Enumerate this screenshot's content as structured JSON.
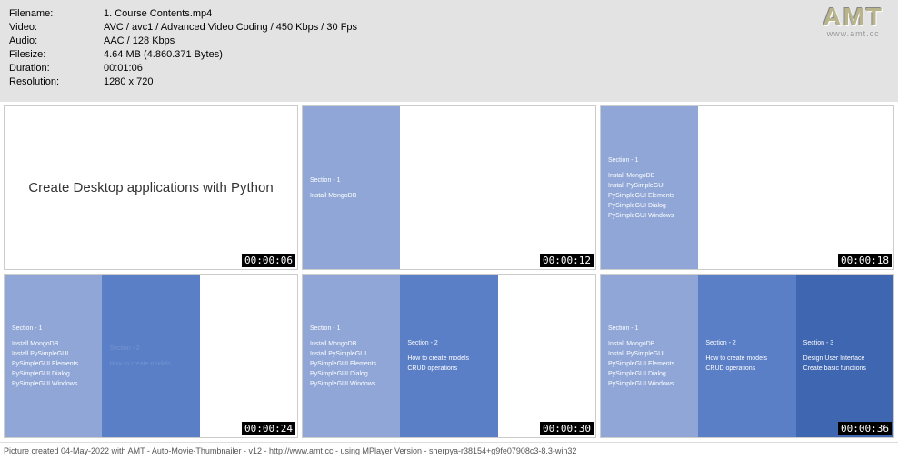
{
  "meta": {
    "filename_label": "Filename:",
    "filename": "1. Course Contents.mp4",
    "video_label": "Video:",
    "video": "AVC / avc1 / Advanced Video Coding / 450 Kbps / 30 Fps",
    "audio_label": "Audio:",
    "audio": "AAC / 128 Kbps",
    "filesize_label": "Filesize:",
    "filesize": "4.64 MB (4.860.371 Bytes)",
    "duration_label": "Duration:",
    "duration": "00:01:06",
    "resolution_label": "Resolution:",
    "resolution": "1280 x 720"
  },
  "logo": {
    "text": "AMT",
    "url": "www.amt.cc"
  },
  "thumbs": {
    "t1": {
      "title": "Create Desktop applications with Python",
      "ts": "00:00:06"
    },
    "t2": {
      "sec": "Section - 1",
      "l1": "Install MongoDB",
      "ts": "00:00:12"
    },
    "t3": {
      "sec": "Section - 1",
      "l1": "Install MongoDB",
      "l2": "Install PySimpleGUI",
      "l3": "PySimpleGUI Elements",
      "l4": "PySimpleGUI Dialog",
      "l5": "PySimpleGUI Windows",
      "ts": "00:00:18"
    },
    "t4": {
      "sec1": "Section - 1",
      "s1l1": "Install MongoDB",
      "s1l2": "Install PySimpleGUI",
      "s1l3": "PySimpleGUI Elements",
      "s1l4": "PySimpleGUI Dialog",
      "s1l5": "PySimpleGUI Windows",
      "sec2": "Section - 2",
      "s2l1": "How to create models",
      "ts": "00:00:24"
    },
    "t5": {
      "sec1": "Section - 1",
      "s1l1": "Install MongoDB",
      "s1l2": "Install PySimpleGUI",
      "s1l3": "PySimpleGUI Elements",
      "s1l4": "PySimpleGUI Dialog",
      "s1l5": "PySimpleGUI Windows",
      "sec2": "Section - 2",
      "s2l1": "How to create models",
      "s2l2": "CRUD operations",
      "ts": "00:00:30"
    },
    "t6": {
      "sec1": "Section - 1",
      "s1l1": "Install MongoDB",
      "s1l2": "Install PySimpleGUI",
      "s1l3": "PySimpleGUI Elements",
      "s1l4": "PySimpleGUI Dialog",
      "s1l5": "PySimpleGUI Windows",
      "sec2": "Section - 2",
      "s2l1": "How to create models",
      "s2l2": "CRUD operations",
      "sec3": "Section - 3",
      "s3l1": "Design User Interface",
      "s3l2": "Create basic functions",
      "ts": "00:00:36"
    }
  },
  "footer": "Picture created 04-May-2022 with AMT - Auto-Movie-Thumbnailer - v12 - http://www.amt.cc - using MPlayer Version - sherpya-r38154+g9fe07908c3-8.3-win32"
}
